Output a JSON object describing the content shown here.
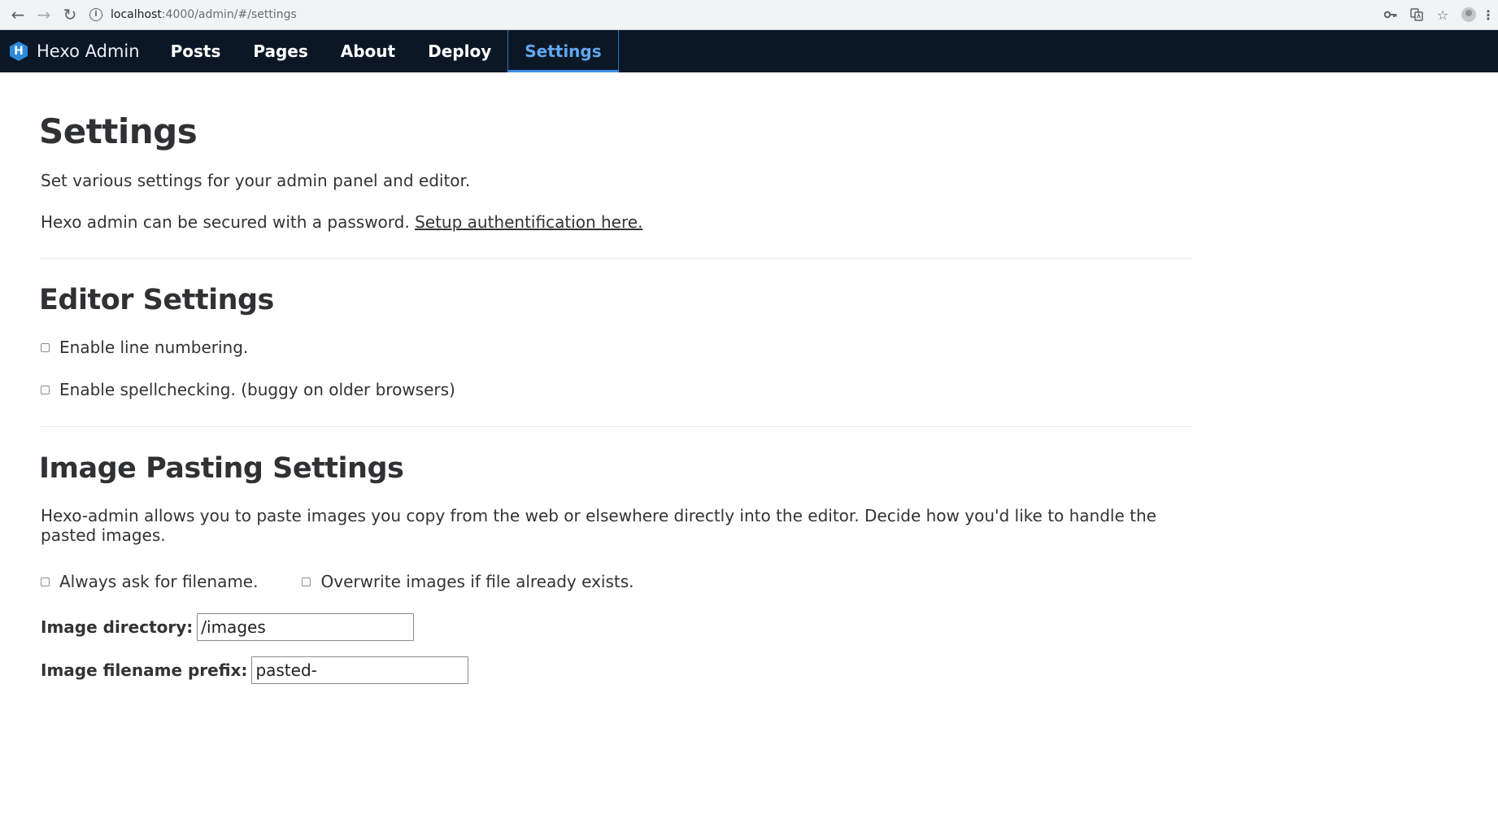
{
  "browser": {
    "url_host": "localhost",
    "url_rest": ":4000/admin/#/settings"
  },
  "navbar": {
    "brand_letter": "H",
    "brand_name": "Hexo Admin",
    "links": [
      "Posts",
      "Pages",
      "About",
      "Deploy",
      "Settings"
    ],
    "active": "Settings",
    "bg_color": "#0c1726",
    "active_color": "#62a7ee"
  },
  "page": {
    "title": "Settings",
    "intro": "Set various settings for your admin panel and editor.",
    "auth_text": "Hexo admin can be secured with a password. ",
    "auth_link": "Setup authentification here."
  },
  "editor_settings": {
    "title": "Editor Settings",
    "line_numbering": "Enable line numbering.",
    "spellcheck": "Enable spellchecking. (buggy on older browsers)"
  },
  "image_settings": {
    "title": "Image Pasting Settings",
    "description": "Hexo-admin allows you to paste images you copy from the web or elsewhere directly into the editor. Decide how you'd like to handle the pasted images.",
    "ask_filename": "Always ask for filename.",
    "overwrite": "Overwrite images if file already exists.",
    "directory_label": "Image directory:",
    "directory_value": "/images",
    "prefix_label": "Image filename prefix:",
    "prefix_value": "pasted-"
  }
}
